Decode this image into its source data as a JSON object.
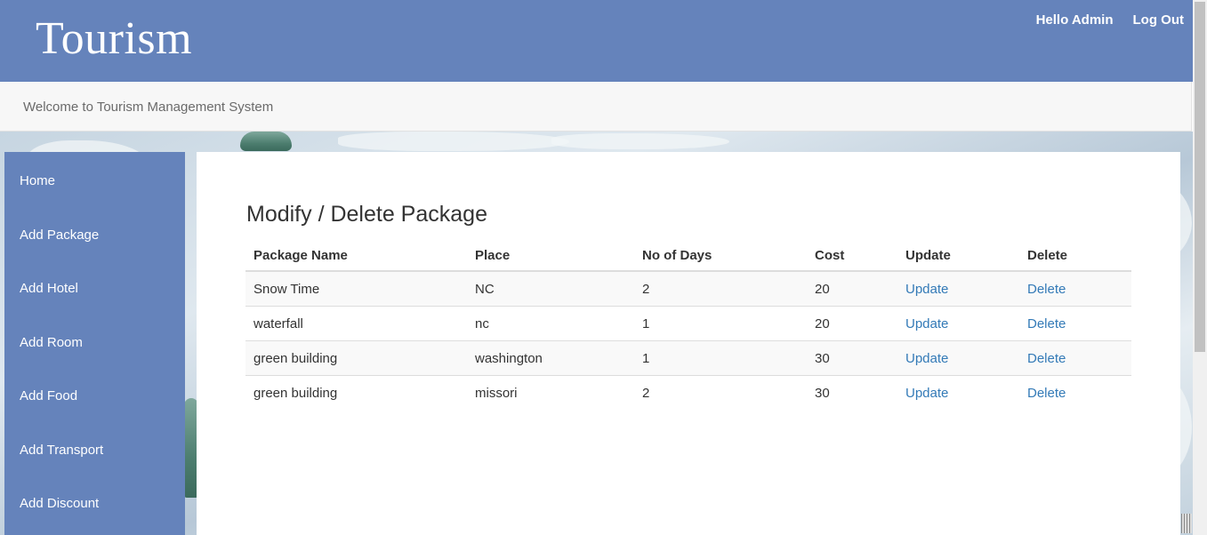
{
  "header": {
    "brand": "Tourism",
    "greeting": "Hello Admin",
    "logout": "Log Out"
  },
  "welcome": "Welcome to Tourism Management System",
  "sidebar": {
    "items": [
      {
        "label": "Home"
      },
      {
        "label": "Add Package"
      },
      {
        "label": "Add Hotel"
      },
      {
        "label": "Add Room"
      },
      {
        "label": "Add Food"
      },
      {
        "label": "Add Transport"
      },
      {
        "label": "Add Discount"
      }
    ]
  },
  "main": {
    "title": "Modify / Delete Package",
    "table": {
      "headers": [
        "Package Name",
        "Place",
        "No of Days",
        "Cost",
        "Update",
        "Delete"
      ],
      "rows": [
        {
          "name": "Snow Time",
          "place": "NC",
          "days": "2",
          "cost": "20",
          "update": "Update",
          "delete": "Delete"
        },
        {
          "name": "waterfall",
          "place": "nc",
          "days": "1",
          "cost": "20",
          "update": "Update",
          "delete": "Delete"
        },
        {
          "name": "green building",
          "place": "washington",
          "days": "1",
          "cost": "30",
          "update": "Update",
          "delete": "Delete"
        },
        {
          "name": "green building",
          "place": "missori",
          "days": "2",
          "cost": "30",
          "update": "Update",
          "delete": "Delete"
        }
      ]
    }
  },
  "colors": {
    "header_bg": "#6583bb",
    "sidebar_bg": "#6583bb",
    "link": "#337ab7"
  }
}
